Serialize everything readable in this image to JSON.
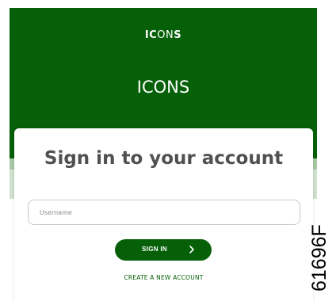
{
  "header": {
    "logo_bold_1": "IC",
    "logo_light": "ON",
    "logo_bold_2": "S",
    "title": "ICONS"
  },
  "card": {
    "title": "Sign in to your account"
  },
  "username": {
    "placeholder": "Username",
    "value": ""
  },
  "signin_button": {
    "label": "SIGN IN",
    "icon": "chevron-right-icon"
  },
  "create_account_link": "CREATE A NEW ACCOUNT",
  "watermark": "61696F",
  "colors": {
    "brand_green": "#056008",
    "strip_dark": "#a8c8a4",
    "strip_light": "#cfe2cd",
    "card_title": "#505050"
  }
}
